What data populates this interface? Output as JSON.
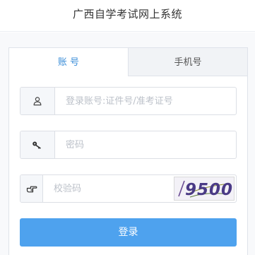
{
  "header": {
    "title": "广西自学考试网上系统"
  },
  "tabs": [
    {
      "label": "账 号",
      "active": true
    },
    {
      "label": "手机号",
      "active": false
    }
  ],
  "form": {
    "account": {
      "placeholder": "登录账号:证件号/准考证号",
      "value": "",
      "icon": "user-icon"
    },
    "password": {
      "placeholder": "密码",
      "value": "",
      "icon": "key-icon"
    },
    "captcha": {
      "placeholder": "校验码",
      "value": "",
      "icon": "pointing-hand-icon",
      "image_text": "9500"
    },
    "submit_label": "登录"
  },
  "colors": {
    "accent": "#3b8ed8",
    "button": "#4ea2ee",
    "border": "#dcdfe5"
  }
}
